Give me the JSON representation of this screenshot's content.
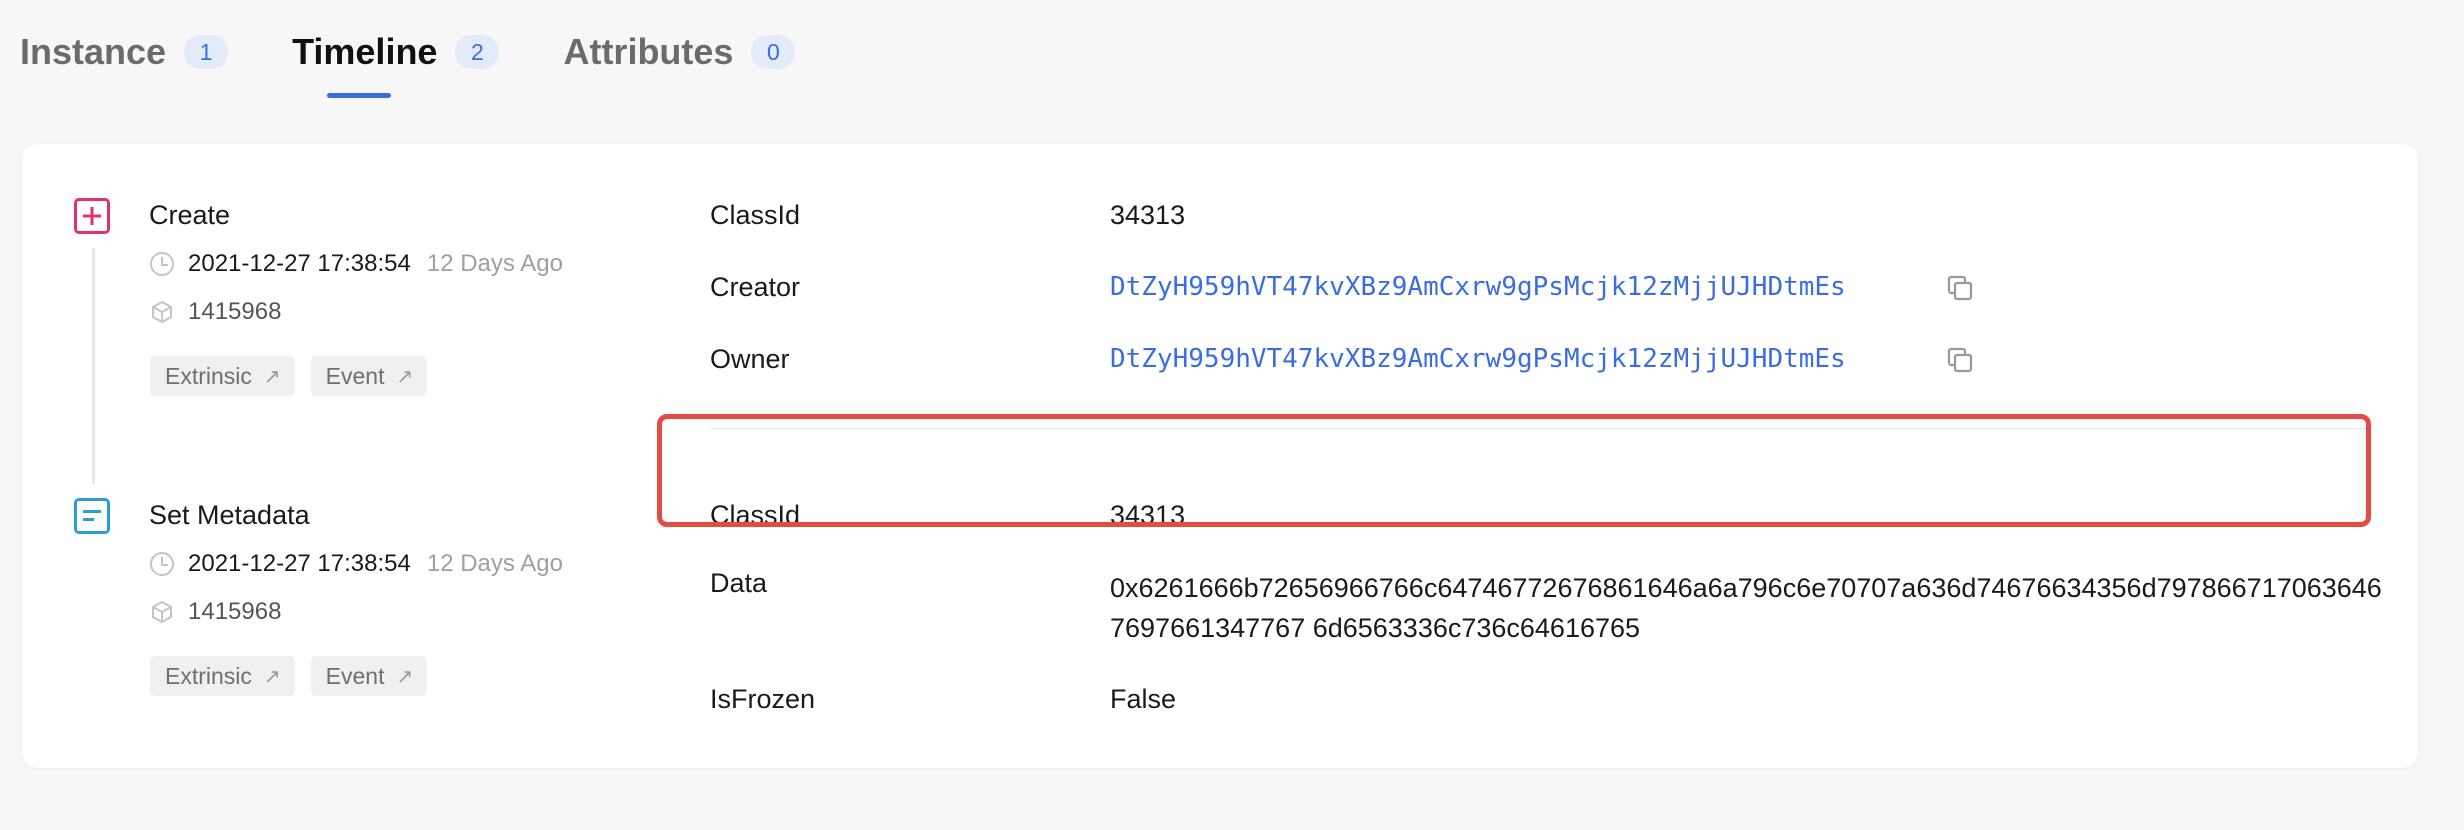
{
  "tabs": [
    {
      "label": "Instance",
      "count": "1"
    },
    {
      "label": "Timeline",
      "count": "2"
    },
    {
      "label": "Attributes",
      "count": "0"
    }
  ],
  "events": [
    {
      "title": "Create",
      "icon": "plus-square-icon",
      "timestamp": "2021-12-27 17:38:54",
      "ago": "12 Days Ago",
      "block": "1415968",
      "tags": [
        "Extrinsic",
        "Event"
      ],
      "fields": [
        {
          "label": "ClassId",
          "value": "34313"
        },
        {
          "label": "Creator",
          "value": "DtZyH959hVT47kvXBz9AmCxrw9gPsMcjk12zMjjUJHDtmEs"
        },
        {
          "label": "Owner",
          "value": "DtZyH959hVT47kvXBz9AmCxrw9gPsMcjk12zMjjUJHDtmEs"
        }
      ]
    },
    {
      "title": "Set Metadata",
      "icon": "document-icon",
      "timestamp": "2021-12-27 17:38:54",
      "ago": "12 Days Ago",
      "block": "1415968",
      "tags": [
        "Extrinsic",
        "Event"
      ],
      "fields": [
        {
          "label": "ClassId",
          "value": "34313"
        },
        {
          "label": "Data",
          "value": "0x6261666b72656966766c64746772676861646a6a796c6e70707a636d74676634356d7978667170636467697661347767 6d6563336c736c64616765"
        },
        {
          "label": "IsFrozen",
          "value": "False"
        }
      ]
    }
  ],
  "colors": {
    "accent": "#3b6de0",
    "create_icon": "#e0336b",
    "meta_icon": "#2a9fd6",
    "highlight": "#e44b45"
  }
}
